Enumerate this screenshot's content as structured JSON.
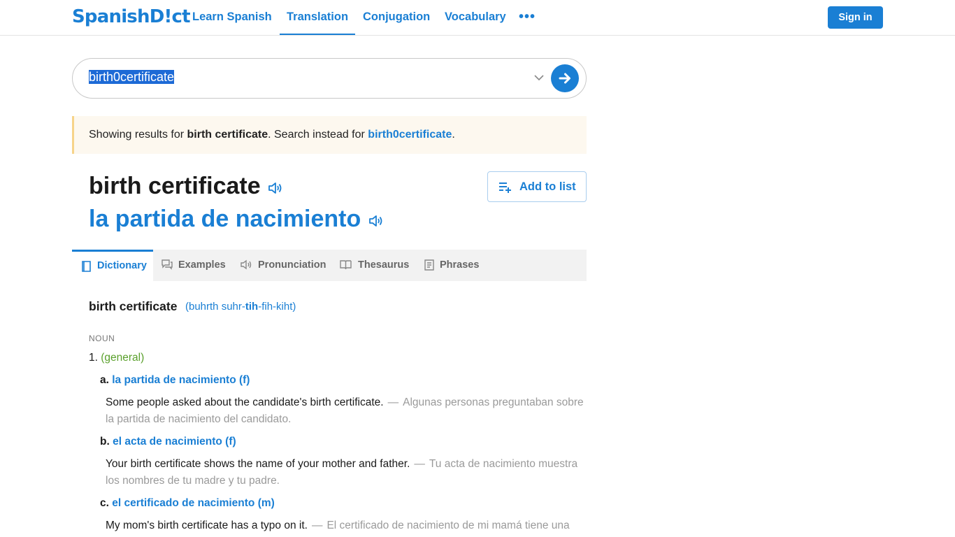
{
  "header": {
    "logo": "SpanishD!ct",
    "nav": [
      "Learn Spanish",
      "Translation",
      "Conjugation",
      "Vocabulary"
    ],
    "more": "•••",
    "signin": "Sign in"
  },
  "search": {
    "value": "birth0certificate"
  },
  "notice": {
    "prefix": "Showing results for ",
    "corrected": "birth certificate",
    "middle": ". Search instead for ",
    "original": "birth0certificate",
    "suffix": "."
  },
  "headword": "birth certificate",
  "translation": "la partida de nacimiento",
  "add_to_list": "Add to list",
  "tabs": [
    "Dictionary",
    "Examples",
    "Pronunciation",
    "Thesaurus",
    "Phrases"
  ],
  "entry": {
    "word": "birth certificate",
    "pron_open": "(buhrth suhr-",
    "pron_stress": "tih",
    "pron_close": "-fih-kiht)",
    "pos": "NOUN",
    "sense_number": "1.",
    "sense_context": "(general)",
    "translations": [
      {
        "letter": "a.",
        "text": "la partida de nacimiento (f)",
        "example_en": "Some people asked about the candidate's birth certificate.",
        "example_es": "Algunas personas preguntaban sobre la partida de nacimiento del candidato."
      },
      {
        "letter": "b.",
        "text": "el acta de nacimiento (f)",
        "example_en": "Your birth certificate shows the name of your mother and father.",
        "example_es": "Tu acta de nacimiento muestra los nombres de tu madre y tu padre."
      },
      {
        "letter": "c.",
        "text": "el certificado de nacimiento (m)",
        "example_en": "My mom's birth certificate has a typo on it.",
        "example_es": "El certificado de nacimiento de mi mamá tiene una"
      }
    ]
  },
  "colors": {
    "brand": "#1a7fd4",
    "context": "#5aa02c",
    "notice_bg": "#fdf8ef",
    "notice_border": "#f7d48a"
  }
}
